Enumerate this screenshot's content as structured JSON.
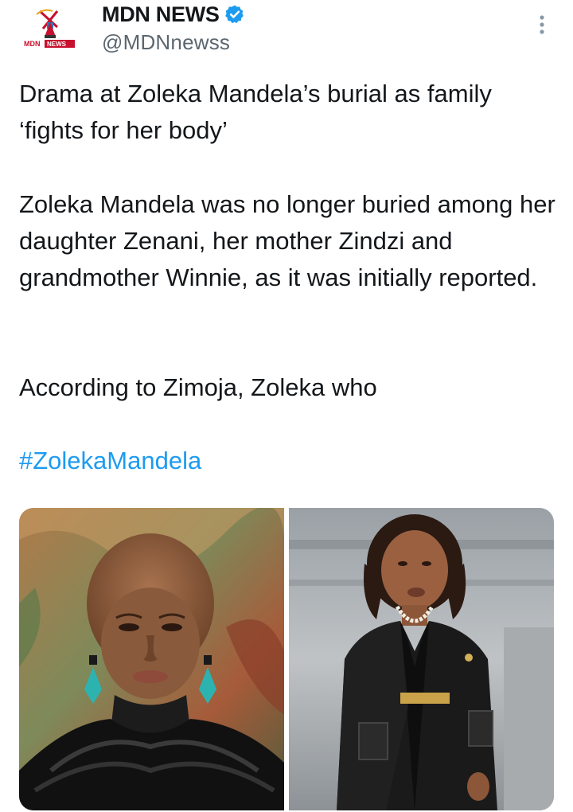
{
  "account": {
    "display_name": "MDN NEWS",
    "handle": "@MDNnewss",
    "verified": true,
    "avatar_logo_text": "MDN NEWS",
    "verified_color": "#1d9bf0"
  },
  "tweet": {
    "headline": "Drama at Zoleka Mandela’s burial as family ‘fights for her body’",
    "paragraph_2": "Zoleka Mandela was no longer buried among her daughter Zenani, her mother Zindzi and grandmother Winnie, as it was initially reported.",
    "paragraph_3": "According to Zimoja, Zoleka who",
    "hashtag": "#ZolekaMandela",
    "hashtag_color": "#1d9bf0"
  },
  "media": {
    "count": 2,
    "photos": [
      {
        "icon": "photo-portrait-woman-earrings"
      },
      {
        "icon": "photo-woman-black-coat"
      }
    ]
  },
  "icons": {
    "more": "more-vertical-icon",
    "verified": "verified-badge-icon"
  }
}
